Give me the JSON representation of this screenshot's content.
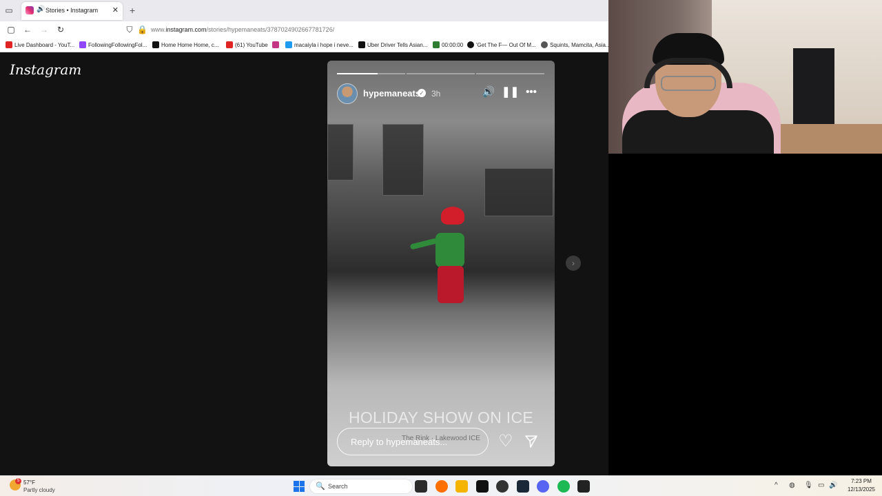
{
  "browser": {
    "tab_title": "Stories • Instagram",
    "url_prefix": "www.",
    "url_domain": "instagram.com",
    "url_path": "/stories/hypemaneats/3787024902667781726/",
    "bookmarks": [
      {
        "label": "Live Dashboard - YouT...",
        "color": "#e02424"
      },
      {
        "label": "FollowingFollowingFol...",
        "color": "#9146ff"
      },
      {
        "label": "Home Home Home, c...",
        "color": "#111111"
      },
      {
        "label": "(61) YouTube",
        "color": "#e02424"
      },
      {
        "label": "macaiyla i hope i neve...",
        "color": "#1d9bf0"
      },
      {
        "label": "Uber Driver Tells Asian...",
        "color": "#111111"
      },
      {
        "label": "00:00:00",
        "color": "#2e7d32"
      },
      {
        "label": "'Get The F— Out Of M...",
        "color": "#111111"
      },
      {
        "label": "Squints, Mamcita, Asia...",
        "color": "#555555"
      }
    ]
  },
  "instagram": {
    "logo": "Instagram",
    "story": {
      "username": "hypemaneats",
      "time": "3h",
      "progress": [
        0.6,
        0,
        0
      ],
      "caption": "HOLIDAY SHOW ON ICE",
      "location_sticker": "The Rink · Lakewood ICE",
      "reply_placeholder": "Reply to hypemaneats..."
    }
  },
  "taskbar": {
    "weather_temp": "57°F",
    "weather_desc": "Partly cloudy",
    "weather_badge": "5",
    "search_label": "Search",
    "time": "7:23 PM",
    "date": "12/13/2025"
  },
  "icons": {
    "mute": "speaker-icon",
    "pause": "pause-icon",
    "more": "more-icon",
    "like": "heart-icon",
    "share": "send-icon",
    "next": "chevron-right-icon"
  }
}
